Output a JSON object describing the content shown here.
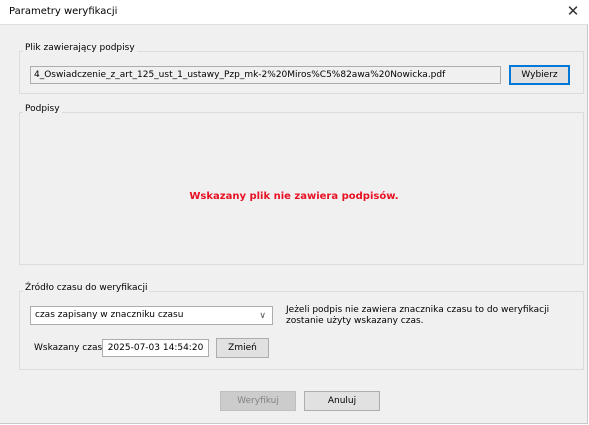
{
  "window": {
    "title": "Parametry weryfikacji"
  },
  "file_group": {
    "legend": "Plik zawierający podpisy",
    "path": "4_Oswiadczenie_z_art_125_ust_1_ustawy_Pzp_mk-2%20Miros%C5%82awa%20Nowicka.pdf",
    "choose_label": "Wybierz"
  },
  "signatures_group": {
    "legend": "Podpisy",
    "empty_message": "Wskazany plik nie zawiera podpisów.",
    "message_color": "#e81123"
  },
  "time_group": {
    "legend": "Źródło czasu do weryfikacji",
    "source_selected": "czas zapisany w znaczniku czasu",
    "note": "Jeżeli podpis nie zawiera znacznika czasu to do weryfikacji zostanie użyty wskazany czas.",
    "time_label": "Wskazany czas:",
    "time_value": "2025-07-03 14:54:20",
    "change_label": "Zmień"
  },
  "footer": {
    "verify_label": "Weryfikuj",
    "cancel_label": "Anuluj"
  }
}
